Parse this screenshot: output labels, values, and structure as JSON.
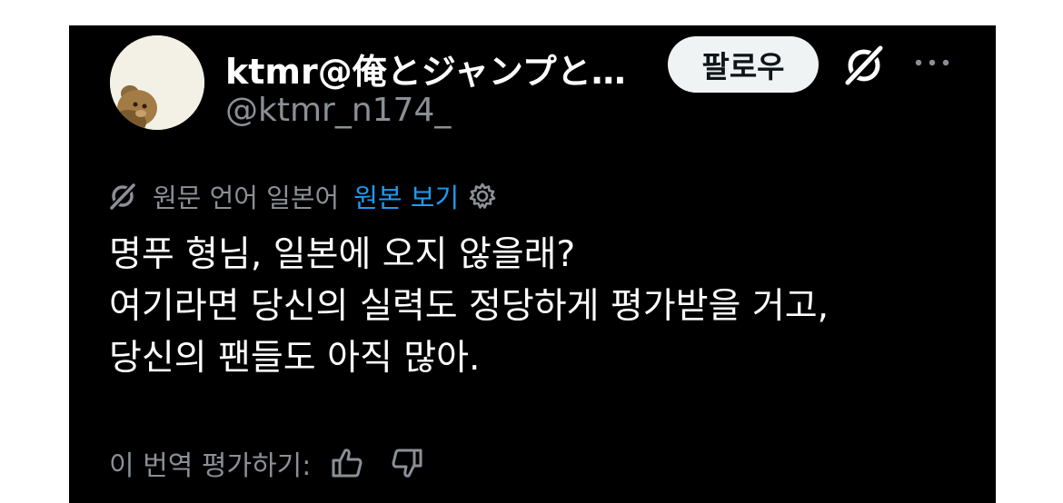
{
  "author": {
    "display_name": "ktmr@俺とジャンプと…",
    "handle": "@ktmr_n174_",
    "avatar": "avatar-image"
  },
  "header": {
    "follow_label": "팔로우",
    "grok_icon": "grok-icon",
    "more_icon": "more-dots-icon"
  },
  "translation": {
    "source_language_text": "원문 언어 일본어",
    "show_original_label": "원본 보기",
    "settings_icon": "gear-icon"
  },
  "tweet": {
    "lines": [
      "명푸 형님, 일본에 오지 않을래?",
      "여기라면 당신의 실력도 정당하게 평가받을 거고,",
      "당신의 팬들도 아직 많아."
    ]
  },
  "rating": {
    "label": "이 번역 평가하기:",
    "thumbs_up_icon": "thumbs-up-icon",
    "thumbs_down_icon": "thumbs-down-icon"
  },
  "colors": {
    "background": "#000000",
    "text": "#ffffff",
    "muted": "#8b9096",
    "link": "#1d9bf0",
    "button_bg": "#eff3f4"
  }
}
